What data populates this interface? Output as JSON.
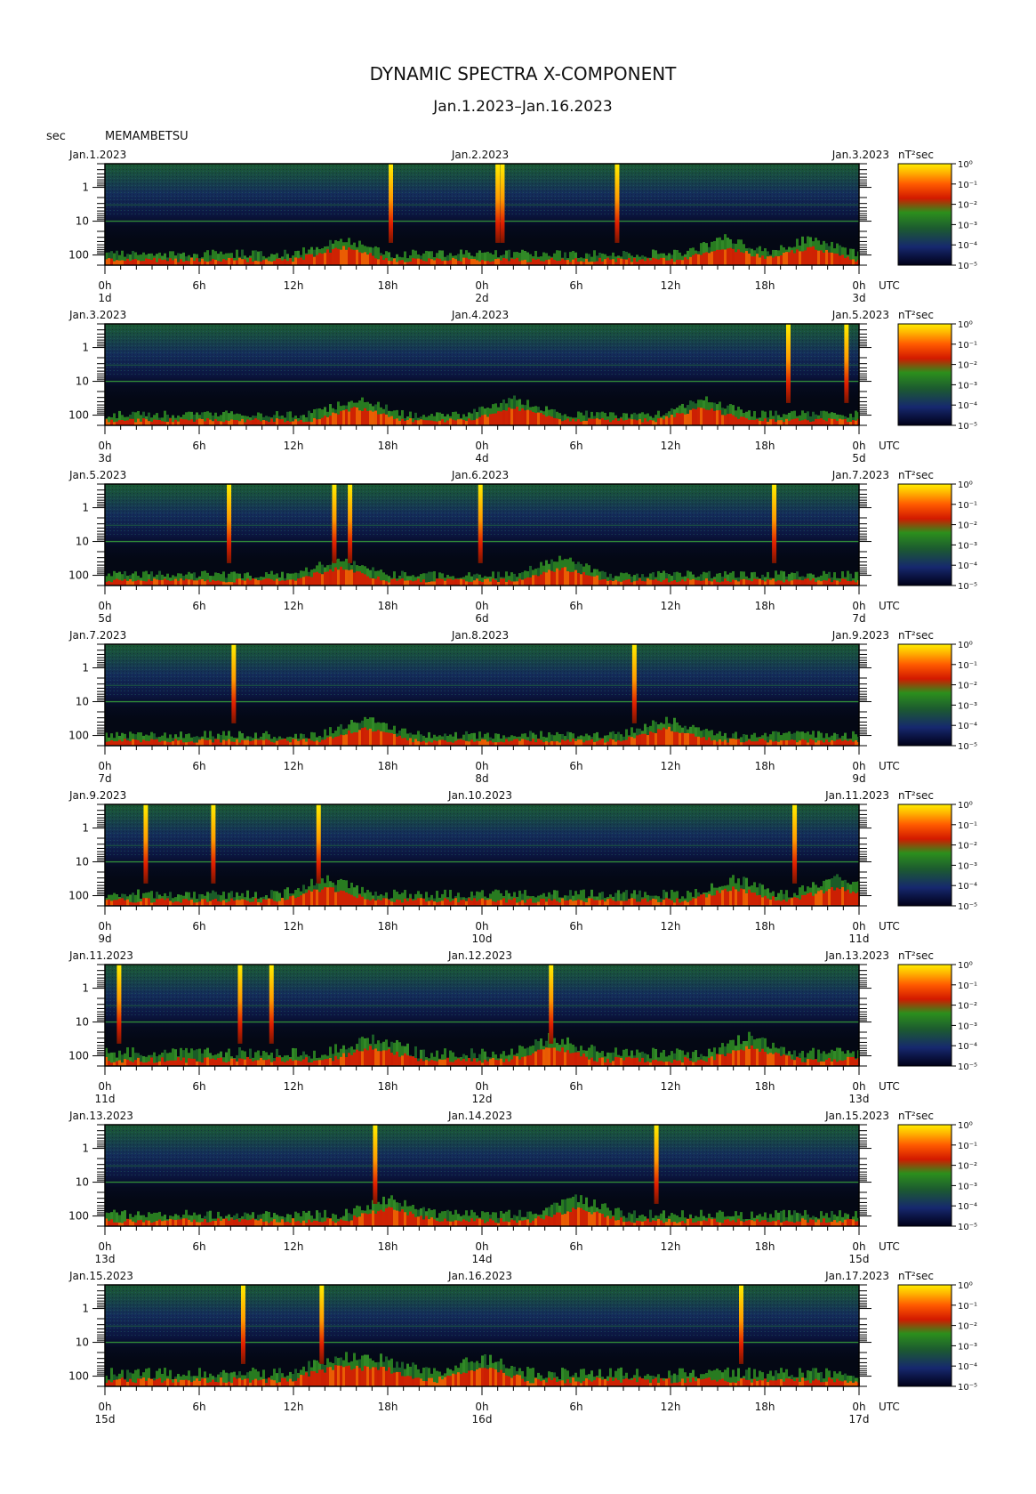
{
  "header": {
    "title": "DYNAMIC SPECTRA X-COMPONENT",
    "subtitle": "Jan.1.2023–Jan.16.2023",
    "y_unit": "sec",
    "station": "MEMAMBETSU",
    "colorbar_unit": "nT²sec"
  },
  "chart_data": {
    "type": "heatmap",
    "title": "DYNAMIC SPECTRA X-COMPONENT",
    "subtitle": "Jan.1.2023–Jan.16.2023",
    "station": "MEMAMBETSU",
    "ylabel": "sec",
    "yscale": "log",
    "yreversed": true,
    "ylim": [
      0.2,
      200
    ],
    "yticks": [
      "1",
      "10",
      "100"
    ],
    "x_tick_labels": [
      "0h",
      "6h",
      "12h",
      "18h",
      "0h",
      "6h",
      "12h",
      "18h",
      "0h"
    ],
    "x_unit": "UTC",
    "colorbar": {
      "unit": "nT²sec",
      "scale": "log",
      "labels": [
        "10⁰",
        "10⁻¹",
        "10⁻²",
        "10⁻³",
        "10⁻⁴",
        "10⁻⁵"
      ],
      "colors": [
        "#000010",
        "#1a2f7a",
        "#1f6e2a",
        "#2f9a1c",
        "#ff1500",
        "#ff8800",
        "#ffee00"
      ]
    },
    "panels": [
      {
        "date_left": "Jan.1.2023",
        "date_mid": "Jan.2.2023",
        "date_right": "Jan.3.2023",
        "day_left": "1d",
        "day_mid": "2d",
        "day_right": "3d",
        "spikes_h": [
          18.2,
          25.0,
          25.3,
          32.6
        ],
        "bursts_h": [
          15.0,
          39.4,
          44.8
        ],
        "activity": 0.55
      },
      {
        "date_left": "Jan.3.2023",
        "date_mid": "Jan.4.2023",
        "date_right": "Jan.5.2023",
        "day_left": "3d",
        "day_mid": "4d",
        "day_right": "5d",
        "spikes_h": [
          43.5,
          47.2
        ],
        "bursts_h": [
          16.0,
          26.0,
          38.0
        ],
        "activity": 0.5
      },
      {
        "date_left": "Jan.5.2023",
        "date_mid": "Jan.6.2023",
        "date_right": "Jan.7.2023",
        "day_left": "5d",
        "day_mid": "6d",
        "day_right": "7d",
        "spikes_h": [
          7.9,
          14.6,
          15.6,
          23.9,
          42.6
        ],
        "bursts_h": [
          14.8,
          29.0
        ],
        "activity": 0.5
      },
      {
        "date_left": "Jan.7.2023",
        "date_mid": "Jan.8.2023",
        "date_right": "Jan.9.2023",
        "day_left": "7d",
        "day_mid": "8d",
        "day_right": "9d",
        "spikes_h": [
          8.2,
          33.7
        ],
        "bursts_h": [
          16.5,
          35.7
        ],
        "activity": 0.5
      },
      {
        "date_left": "Jan.9.2023",
        "date_mid": "Jan.10.2023",
        "date_right": "Jan.11.2023",
        "day_left": "9d",
        "day_mid": "10d",
        "day_right": "11d",
        "spikes_h": [
          2.6,
          6.9,
          13.6,
          43.9
        ],
        "bursts_h": [
          14.0,
          40.0,
          46.5
        ],
        "activity": 0.6
      },
      {
        "date_left": "Jan.11.2023",
        "date_mid": "Jan.12.2023",
        "date_right": "Jan.13.2023",
        "day_left": "11d",
        "day_mid": "12d",
        "day_right": "13d",
        "spikes_h": [
          0.9,
          8.6,
          10.6,
          28.4
        ],
        "bursts_h": [
          17.0,
          28.5,
          41.0
        ],
        "activity": 0.75
      },
      {
        "date_left": "Jan.13.2023",
        "date_mid": "Jan.14.2023",
        "date_right": "Jan.15.2023",
        "day_left": "13d",
        "day_mid": "14d",
        "day_right": "15d",
        "spikes_h": [
          17.2,
          35.1
        ],
        "bursts_h": [
          18.0,
          30.0
        ],
        "activity": 0.6
      },
      {
        "date_left": "Jan.15.2023",
        "date_mid": "Jan.16.2023",
        "date_right": "Jan.17.2023",
        "day_left": "15d",
        "day_mid": "16d",
        "day_right": "17d",
        "spikes_h": [
          8.8,
          13.8,
          40.5
        ],
        "bursts_h": [
          14.5,
          17.5,
          24.0
        ],
        "activity": 0.75
      }
    ]
  }
}
